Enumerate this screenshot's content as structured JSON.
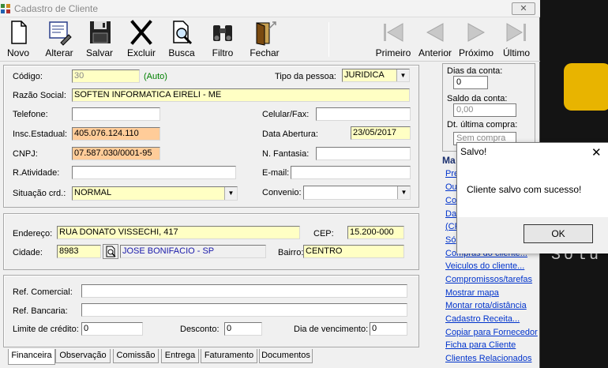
{
  "window": {
    "title": "Cadastro de Cliente",
    "close": "✕"
  },
  "toolbar": {
    "novo": "Novo",
    "alterar": "Alterar",
    "salvar": "Salvar",
    "excluir": "Excluir",
    "busca": "Busca",
    "filtro": "Filtro",
    "fechar": "Fechar",
    "primeiro": "Primeiro",
    "anterior": "Anterior",
    "proximo": "Próximo",
    "ultimo": "Último"
  },
  "form": {
    "codigo_label": "Código:",
    "codigo": "30",
    "auto": "(Auto)",
    "tipo_label": "Tipo da pessoa:",
    "tipo": "JURIDICA",
    "razao_label": "Razão Social:",
    "razao": "SOFTEN INFORMATICA EIRELI - ME",
    "telefone_label": "Telefone:",
    "telefone": "",
    "celular_label": "Celular/Fax:",
    "celular": "",
    "insc_label": "Insc.Estadual:",
    "insc": "405.076.124.110",
    "abertura_label": "Data Abertura:",
    "abertura": "23/05/2017",
    "cnpj_label": "CNPJ:",
    "cnpj": "07.587.030/0001-95",
    "fantasia_label": "N. Fantasia:",
    "fantasia": "",
    "atividade_label": "R.Atividade:",
    "atividade": "",
    "email_label": "E-mail:",
    "email": "",
    "situacao_label": "Situação crd.:",
    "situacao": "NORMAL",
    "convenio_label": "Convenio:",
    "convenio": ""
  },
  "address": {
    "endereco_label": "Endereço:",
    "endereco": "RUA DONATO VISSECHI, 417",
    "cep_label": "CEP:",
    "cep": "15.200-000",
    "cidade_label": "Cidade:",
    "cidade_code": "8983",
    "cidade_nome": "JOSE BONIFACIO - SP",
    "bairro_label": "Bairro:",
    "bairro": "CENTRO"
  },
  "refs": {
    "comercial_label": "Ref. Comercial:",
    "comercial": "",
    "bancaria_label": "Ref. Bancaria:",
    "bancaria": "",
    "limite_label": "Limite de crédito:",
    "limite": "0",
    "desconto_label": "Desconto:",
    "desconto": "0",
    "vencimento_label": "Dia de vencimento:",
    "vencimento": "0"
  },
  "tabs": [
    "Financeira",
    "Observação",
    "Comissão",
    "Entrega",
    "Faturamento",
    "Documentos"
  ],
  "side": {
    "dias_label": "Dias da conta:",
    "dias": "0",
    "saldo_label": "Saldo da conta:",
    "saldo": "0,00",
    "ultima_label": "Dt. última compra:",
    "ultima": "Sem compra",
    "menu_title": "Ma",
    "links": [
      "Pre",
      "Ou",
      "Co",
      "Da",
      "(CF",
      "Só",
      "Compras do cliente...",
      "Veiculos do cliente...",
      "Compromissos/tarefas",
      "Mostrar mapa",
      "Montar rota/distância",
      "Cadastro Receita...",
      "Copiar para Fornecedor",
      "Ficha para Cliente",
      "Clientes Relacionados"
    ]
  },
  "dialog": {
    "title": "Salvo!",
    "close": "✕",
    "message": "Cliente salvo com sucesso!",
    "ok": "OK"
  },
  "desktop": {
    "text": "Solu"
  }
}
